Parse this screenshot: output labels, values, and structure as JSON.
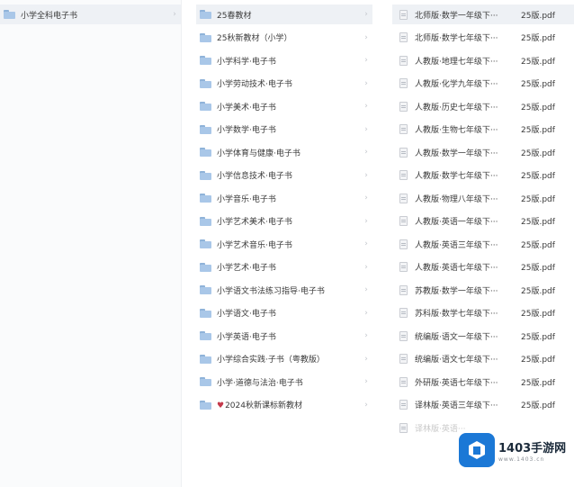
{
  "pane1": {
    "items": [
      {
        "label": "小学全科电子书",
        "icon": "folder-icon",
        "selected": true
      }
    ]
  },
  "pane2": {
    "items": [
      {
        "label": "25春教材",
        "selected": true
      },
      {
        "label": "25秋新教材（小学）"
      },
      {
        "label": "小学科学·电子书"
      },
      {
        "label": "小学劳动技术·电子书"
      },
      {
        "label": "小学美术·电子书"
      },
      {
        "label": "小学数学·电子书"
      },
      {
        "label": "小学体育与健康·电子书"
      },
      {
        "label": "小学信息技术·电子书"
      },
      {
        "label": "小学音乐·电子书"
      },
      {
        "label": "小学艺术美术·电子书"
      },
      {
        "label": "小学艺术音乐·电子书"
      },
      {
        "label": "小学艺术·电子书"
      },
      {
        "label": "小学语文书法练习指导·电子书"
      },
      {
        "label": "小学语文·电子书"
      },
      {
        "label": "小学英语·电子书"
      },
      {
        "label": "小学综合实践·子书（粤教版）"
      },
      {
        "label": "小学·道德与法治·电子书"
      },
      {
        "label": "2024秋新课标新教材",
        "heart": "♥"
      }
    ]
  },
  "pane3": {
    "items": [
      {
        "label": "北师版·数学一年级下···",
        "suffix": "25版.pdf",
        "selected": true
      },
      {
        "label": "北师版·数学七年级下···",
        "suffix": "25版.pdf"
      },
      {
        "label": "人教版·地理七年级下···",
        "suffix": "25版.pdf"
      },
      {
        "label": "人教版·化学九年级下···",
        "suffix": "25版.pdf"
      },
      {
        "label": "人教版·历史七年级下···",
        "suffix": "25版.pdf"
      },
      {
        "label": "人教版·生物七年级下···",
        "suffix": "25版.pdf"
      },
      {
        "label": "人教版·数学一年级下···",
        "suffix": "25版.pdf"
      },
      {
        "label": "人教版·数学七年级下···",
        "suffix": "25版.pdf"
      },
      {
        "label": "人教版·物理八年级下···",
        "suffix": "25版.pdf"
      },
      {
        "label": "人教版·英语一年级下···",
        "suffix": "25版.pdf"
      },
      {
        "label": "人教版·英语三年级下···",
        "suffix": "25版.pdf"
      },
      {
        "label": "人教版·英语七年级下···",
        "suffix": "25版.pdf"
      },
      {
        "label": "苏教版·数学一年级下···",
        "suffix": "25版.pdf"
      },
      {
        "label": "苏科版·数学七年级下···",
        "suffix": "25版.pdf"
      },
      {
        "label": "统编版·语文一年级下···",
        "suffix": "25版.pdf"
      },
      {
        "label": "统编版·语文七年级下···",
        "suffix": "25版.pdf"
      },
      {
        "label": "外研版·英语七年级下···",
        "suffix": "25版.pdf"
      },
      {
        "label": "译林版·英语三年级下···",
        "suffix": "25版.pdf"
      },
      {
        "label": "译林版·英语···",
        "suffix": "",
        "faded": true
      }
    ]
  },
  "watermark": {
    "title": "1403手游网",
    "url": "www.1403.cn",
    "brand_color": "#1b78d6"
  },
  "chevron_glyph": "›"
}
